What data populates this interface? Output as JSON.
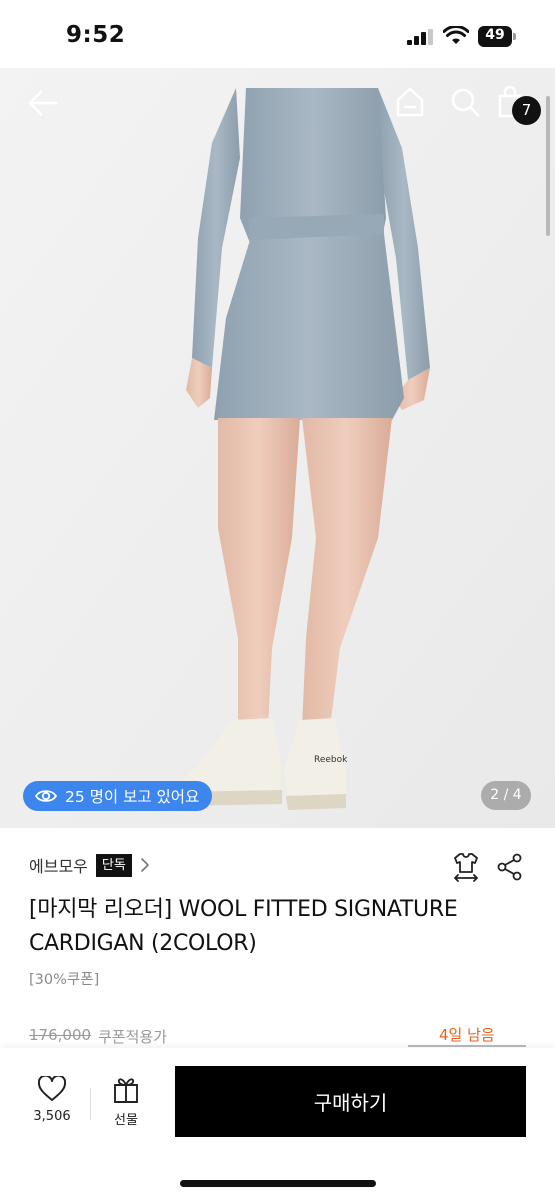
{
  "status_bar": {
    "time": "9:52",
    "battery": "49"
  },
  "nav": {
    "cart_count": "7"
  },
  "gallery": {
    "viewers_text": "25 명이 보고 있어요",
    "page_indicator": "2 / 4"
  },
  "product": {
    "brand": "에브모우",
    "exclusive_badge": "단독",
    "title": "[마지막 리오더] WOOL FITTED SIGNATURE CARDIGAN (2COLOR)",
    "coupon_tag": "[30%쿠폰]",
    "original_price": "176,000",
    "price_label": "쿠폰적용가",
    "days_left": "4일 남음"
  },
  "bottom_bar": {
    "like_count": "3,506",
    "gift_label": "선물",
    "buy_label": "구매하기"
  },
  "colors": {
    "viewers_pill": "#3d86ee",
    "days_left": "#e8621a",
    "buy_button": "#000000"
  },
  "icons": [
    "back-arrow-icon",
    "home-icon",
    "search-icon",
    "shopping-bag-icon",
    "eye-icon",
    "chevron-right-icon",
    "fit-size-icon",
    "share-icon",
    "heart-icon",
    "gift-icon"
  ]
}
